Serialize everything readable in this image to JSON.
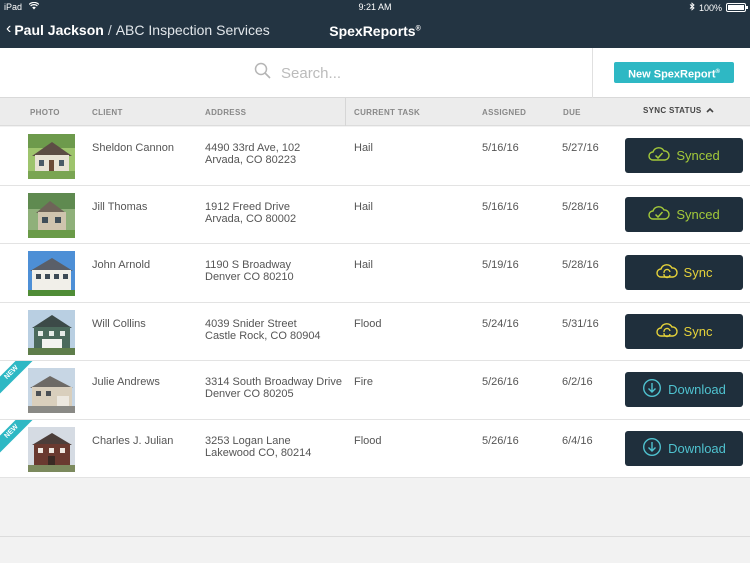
{
  "status_bar": {
    "device": "iPad",
    "time": "9:21 AM",
    "battery": "100%",
    "battery_level": 1.0
  },
  "nav": {
    "user": "Paul Jackson",
    "separator": "/",
    "company": "ABC Inspection Services",
    "title": "SpexReports",
    "title_mark": "®"
  },
  "search": {
    "placeholder": "Search..."
  },
  "new_button": {
    "label": "New SpexReport",
    "mark": "®"
  },
  "columns": {
    "photo": "PHOTO",
    "client": "CLIENT",
    "address": "ADDRESS",
    "current_task": "CURRENT TASK",
    "assigned": "ASSIGNED",
    "due": "DUE",
    "sync_status": "SYNC STATUS"
  },
  "badge_new": "NEW",
  "colors": {
    "navy": "#233442",
    "teal": "#2eb8c4",
    "synced": "#a3c93a",
    "sync": "#e5d23a",
    "download": "#4fc2cf",
    "button_bg": "#1f2f3c"
  },
  "rows": [
    {
      "client": "Sheldon Cannon",
      "address1": "4490 33rd Ave, 102",
      "address2": "Arvada, CO 80223",
      "task": "Hail",
      "assigned": "5/16/16",
      "due": "5/27/16",
      "status": "Synced",
      "status_type": "synced",
      "is_new": false,
      "photo": "house-photo-1"
    },
    {
      "client": "Jill Thomas",
      "address1": "1912 Freed Drive",
      "address2": "Arvada, CO 80002",
      "task": "Hail",
      "assigned": "5/16/16",
      "due": "5/28/16",
      "status": "Synced",
      "status_type": "synced",
      "is_new": false,
      "photo": "house-photo-2"
    },
    {
      "client": "John Arnold",
      "address1": "1190 S Broadway",
      "address2": "Denver CO 80210",
      "task": "Hail",
      "assigned": "5/19/16",
      "due": "5/28/16",
      "status": "Sync",
      "status_type": "sync",
      "is_new": false,
      "photo": "house-photo-3"
    },
    {
      "client": "Will Collins",
      "address1": "4039 Snider Street",
      "address2": "Castle Rock, CO 80904",
      "task": "Flood",
      "assigned": "5/24/16",
      "due": "5/31/16",
      "status": "Sync",
      "status_type": "sync",
      "is_new": false,
      "photo": "house-photo-4"
    },
    {
      "client": "Julie Andrews",
      "address1": "3314 South Broadway Drive",
      "address2": "Denver CO 80205",
      "task": "Fire",
      "assigned": "5/26/16",
      "due": "6/2/16",
      "status": "Download",
      "status_type": "download",
      "is_new": true,
      "photo": "house-photo-5"
    },
    {
      "client": "Charles J. Julian",
      "address1": "3253 Logan Lane",
      "address2": "Lakewood CO, 80214",
      "task": "Flood",
      "assigned": "5/26/16",
      "due": "6/4/16",
      "status": "Download",
      "status_type": "download",
      "is_new": true,
      "photo": "house-photo-6"
    }
  ]
}
